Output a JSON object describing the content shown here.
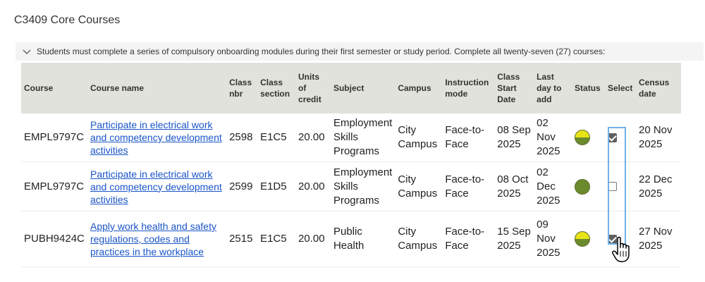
{
  "page": {
    "title": "C3409 Core Courses"
  },
  "notice": {
    "text": "Students must complete a series of compulsory onboarding modules during their first semester or study period. Complete all twenty-seven (27) courses:",
    "icon": "chevron-down-icon"
  },
  "table": {
    "headers": {
      "course": "Course",
      "course_name": "Course name",
      "class_nbr": "Class nbr",
      "class_section": "Class section",
      "units_of_credit": "Units of credit",
      "subject": "Subject",
      "campus": "Campus",
      "instruction_mode": "Instruction mode",
      "class_start_date": "Class Start Date",
      "last_day_to_add": "Last day to add",
      "status": "Status",
      "select": "Select",
      "census_date": "Census date"
    },
    "rows": [
      {
        "course": "EMPL9797C",
        "course_name": "Participate in electrical work and competency development activities",
        "class_nbr": "2598",
        "class_section": "E1C5",
        "units": "20.00",
        "subject": "Employment Skills Programs",
        "campus": "City Campus",
        "mode": "Face-to-Face",
        "start_date": "08 Sep 2025",
        "last_day": "02 Nov 2025",
        "status": "half-yellow-half-green",
        "selected": true,
        "census_date": "20 Nov 2025"
      },
      {
        "course": "EMPL9797C",
        "course_name": "Participate in electrical work and competency development activities",
        "class_nbr": "2599",
        "class_section": "E1D5",
        "units": "20.00",
        "subject": "Employment Skills Programs",
        "campus": "City Campus",
        "mode": "Face-to-Face",
        "start_date": "08 Oct 2025",
        "last_day": "02 Dec 2025",
        "status": "green",
        "selected": false,
        "census_date": "22 Dec 2025"
      },
      {
        "course": "PUBH9424C",
        "course_name": "Apply work health and safety regulations, codes and practices in the workplace",
        "class_nbr": "2515",
        "class_section": "E1C5",
        "units": "20.00",
        "subject": "Public Health",
        "campus": "City Campus",
        "mode": "Face-to-Face",
        "start_date": "15 Sep 2025",
        "last_day": "09 Nov 2025",
        "status": "half-yellow-half-green",
        "selected": true,
        "census_date": "27 Nov 2025"
      }
    ]
  },
  "colors": {
    "link": "#1a55c8",
    "header_bg": "#e2e2dc",
    "status_yellow": "#e8e317",
    "status_green": "#6b8a2c",
    "highlight": "#6fb1e8"
  }
}
